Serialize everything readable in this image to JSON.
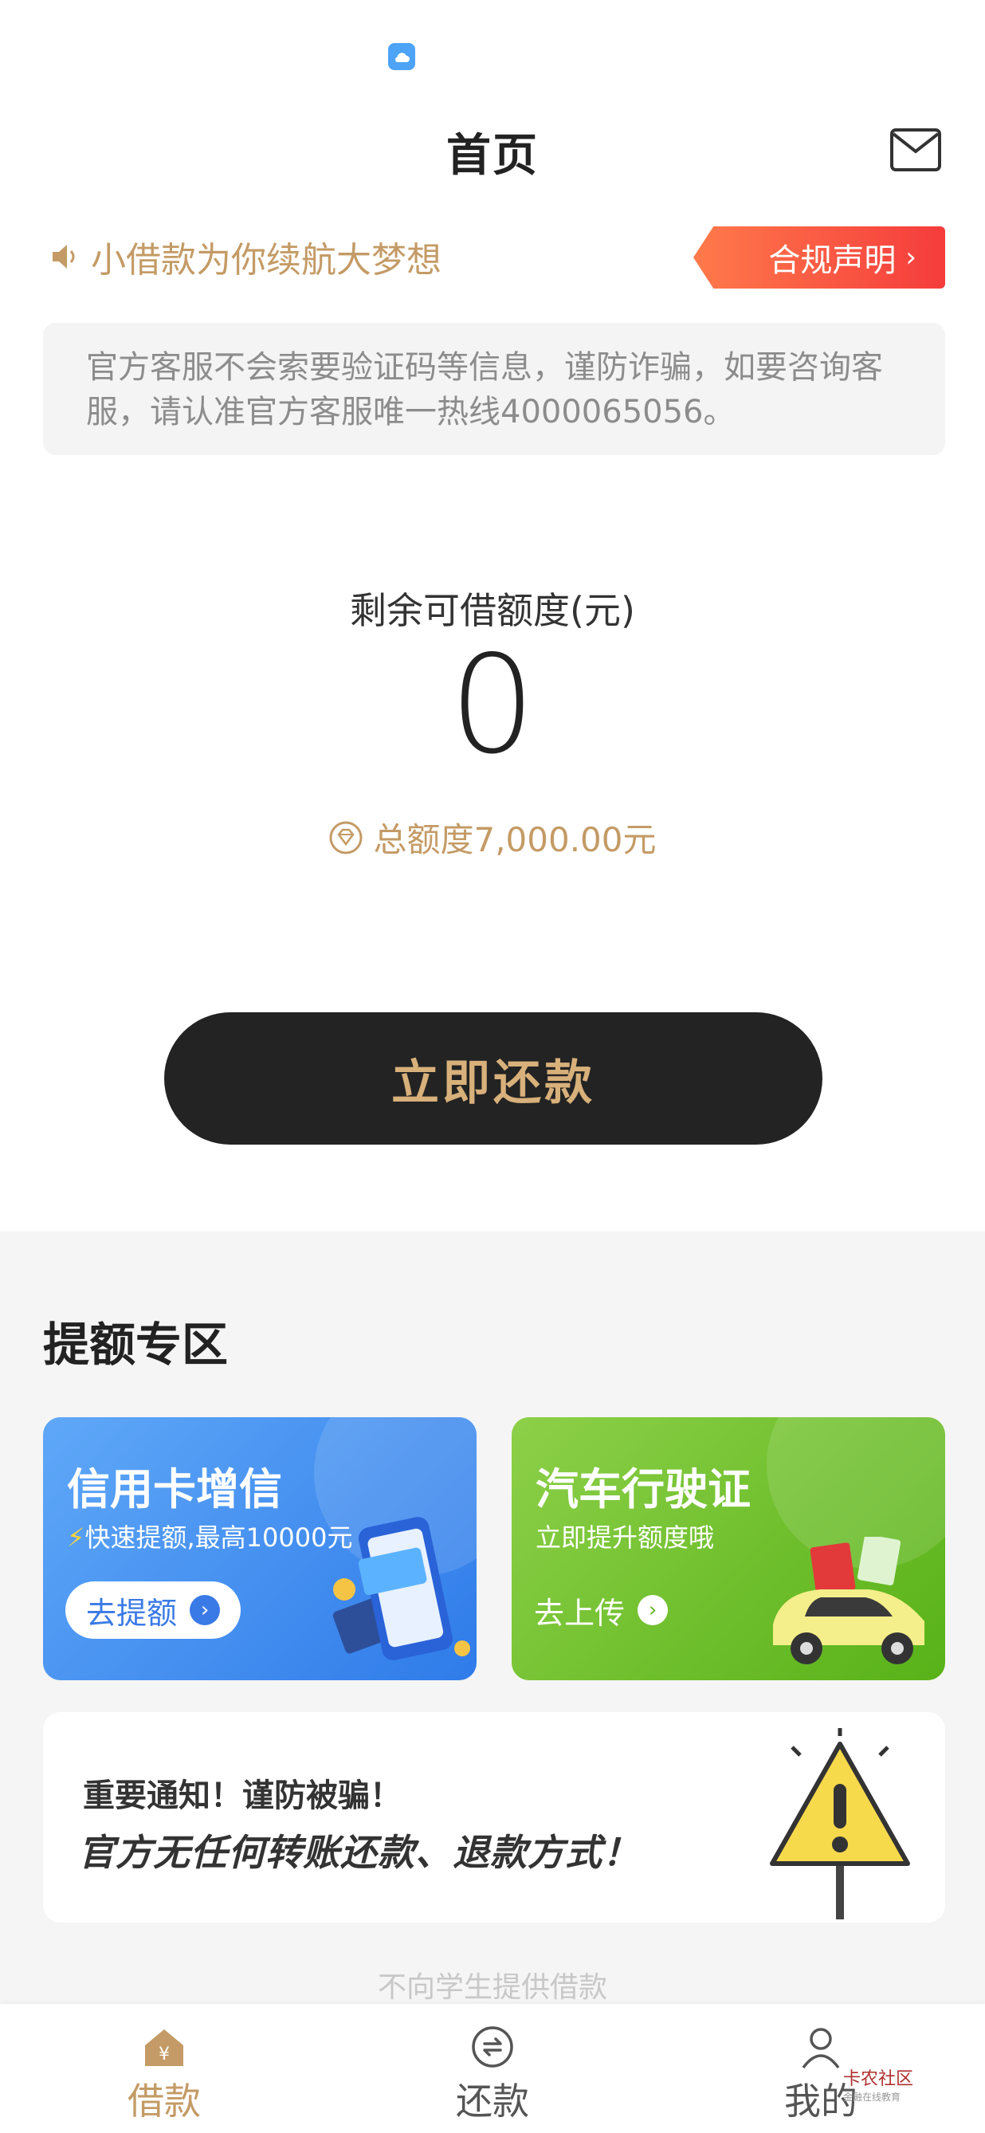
{
  "header": {
    "title": "首页"
  },
  "banner": {
    "slogan": "小借款为你续航大梦想",
    "compliance_label": "合规声明"
  },
  "notice": {
    "text": "官方客服不会索要验证码等信息，谨防诈骗，如要咨询客服，请认准官方客服唯一热线4000065056。"
  },
  "quota": {
    "label": "剩余可借额度(元)",
    "value": "0",
    "total_text": "总额度7,000.00元"
  },
  "actions": {
    "repay_now": "立即还款"
  },
  "boost": {
    "section_title": "提额专区",
    "credit_card": {
      "title": "信用卡增信",
      "subtitle": "快速提额,最高10000元",
      "button": "去提额"
    },
    "vehicle_license": {
      "title": "汽车行驶证",
      "subtitle": "立即提升额度哦",
      "button": "去上传"
    }
  },
  "warning": {
    "line1": "重要通知！谨防被骗！",
    "line2": "官方无任何转账还款、退款方式！"
  },
  "footer_note": "不向学生提供借款",
  "tabbar": {
    "items": [
      {
        "label": "借款",
        "icon": "home-yuan-icon",
        "active": true
      },
      {
        "label": "还款",
        "icon": "repay-icon",
        "active": false
      },
      {
        "label": "我的",
        "icon": "user-icon",
        "active": false
      }
    ]
  },
  "watermark": {
    "text": "卡农社区",
    "sub": "金融在线教育"
  },
  "colors": {
    "accent_gold": "#c49b66",
    "button_dark": "#232323",
    "compliance_red": "#f53c3c",
    "card_blue": "#3a7ae6",
    "card_green": "#62b627"
  }
}
